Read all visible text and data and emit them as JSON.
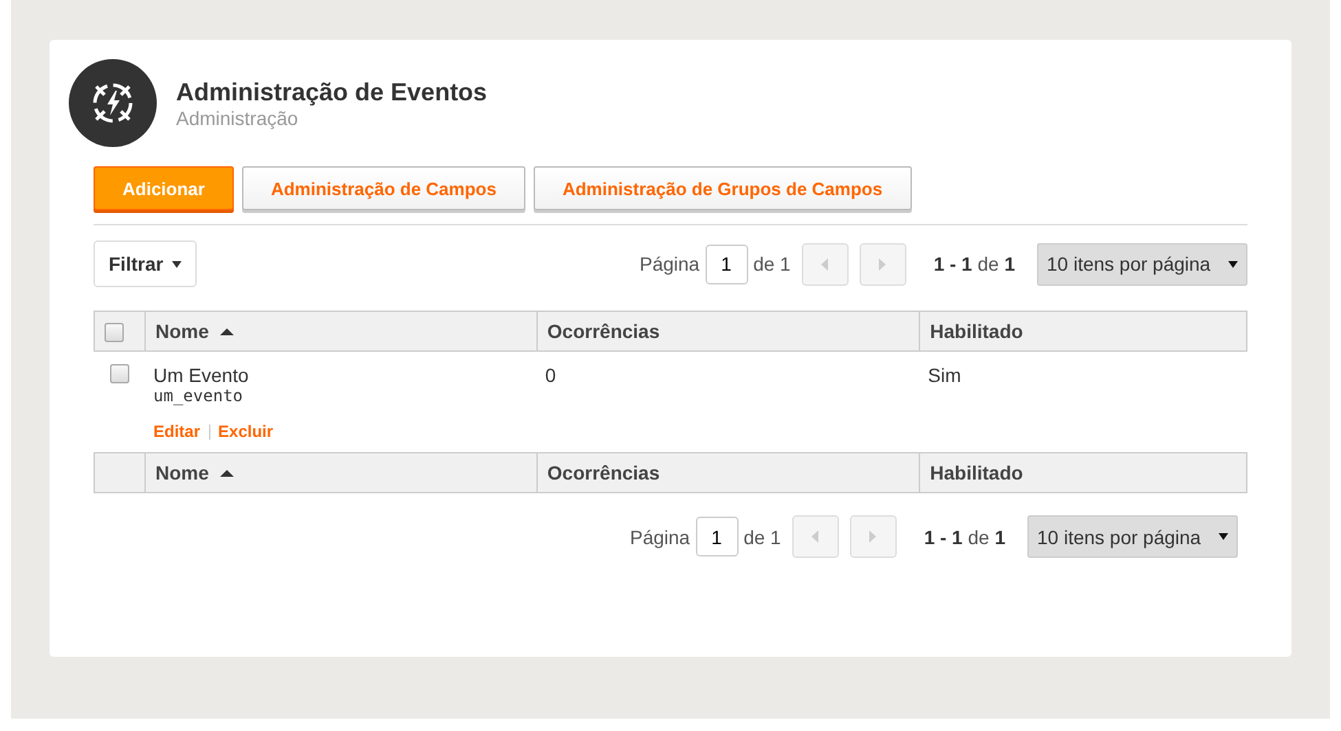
{
  "header": {
    "title": "Administração de Eventos",
    "subtitle": "Administração"
  },
  "actions": [
    {
      "label": "Adicionar",
      "kind": "primary"
    },
    {
      "label": "Administração de Campos",
      "kind": "secondary"
    },
    {
      "label": "Administração de Grupos de Campos",
      "kind": "secondary"
    }
  ],
  "filter": {
    "label": "Filtrar"
  },
  "pagination_top": {
    "page_label": "Página",
    "page": "1",
    "of_pages": "de 1",
    "prev_disabled": true,
    "next_disabled": true,
    "range": "1 - 1",
    "of_label": "de",
    "total": "1",
    "per_page": "10 itens por página"
  },
  "table": {
    "select_all_checked": false,
    "columns": [
      {
        "label": "Nome",
        "sorted": true
      },
      {
        "label": "Ocorrências",
        "sorted": false
      },
      {
        "label": "Habilitado",
        "sorted": false
      }
    ],
    "rows": [
      {
        "checked": false,
        "name": "Um Evento",
        "slug": "um_evento",
        "occurrences": "0",
        "enabled": "Sim",
        "actions": [
          "Editar",
          "Excluir"
        ]
      }
    ],
    "footer_columns": [
      {
        "label": "Nome",
        "sorted": true
      },
      {
        "label": "Ocorrências",
        "sorted": false
      },
      {
        "label": "Habilitado",
        "sorted": false
      }
    ]
  },
  "pagination_bottom": {
    "page_label": "Página",
    "page": "1",
    "of_pages": "de 1",
    "prev_disabled": true,
    "next_disabled": true,
    "range": "1 - 1",
    "of_label": "de",
    "total": "1",
    "per_page": "10 itens por página"
  }
}
